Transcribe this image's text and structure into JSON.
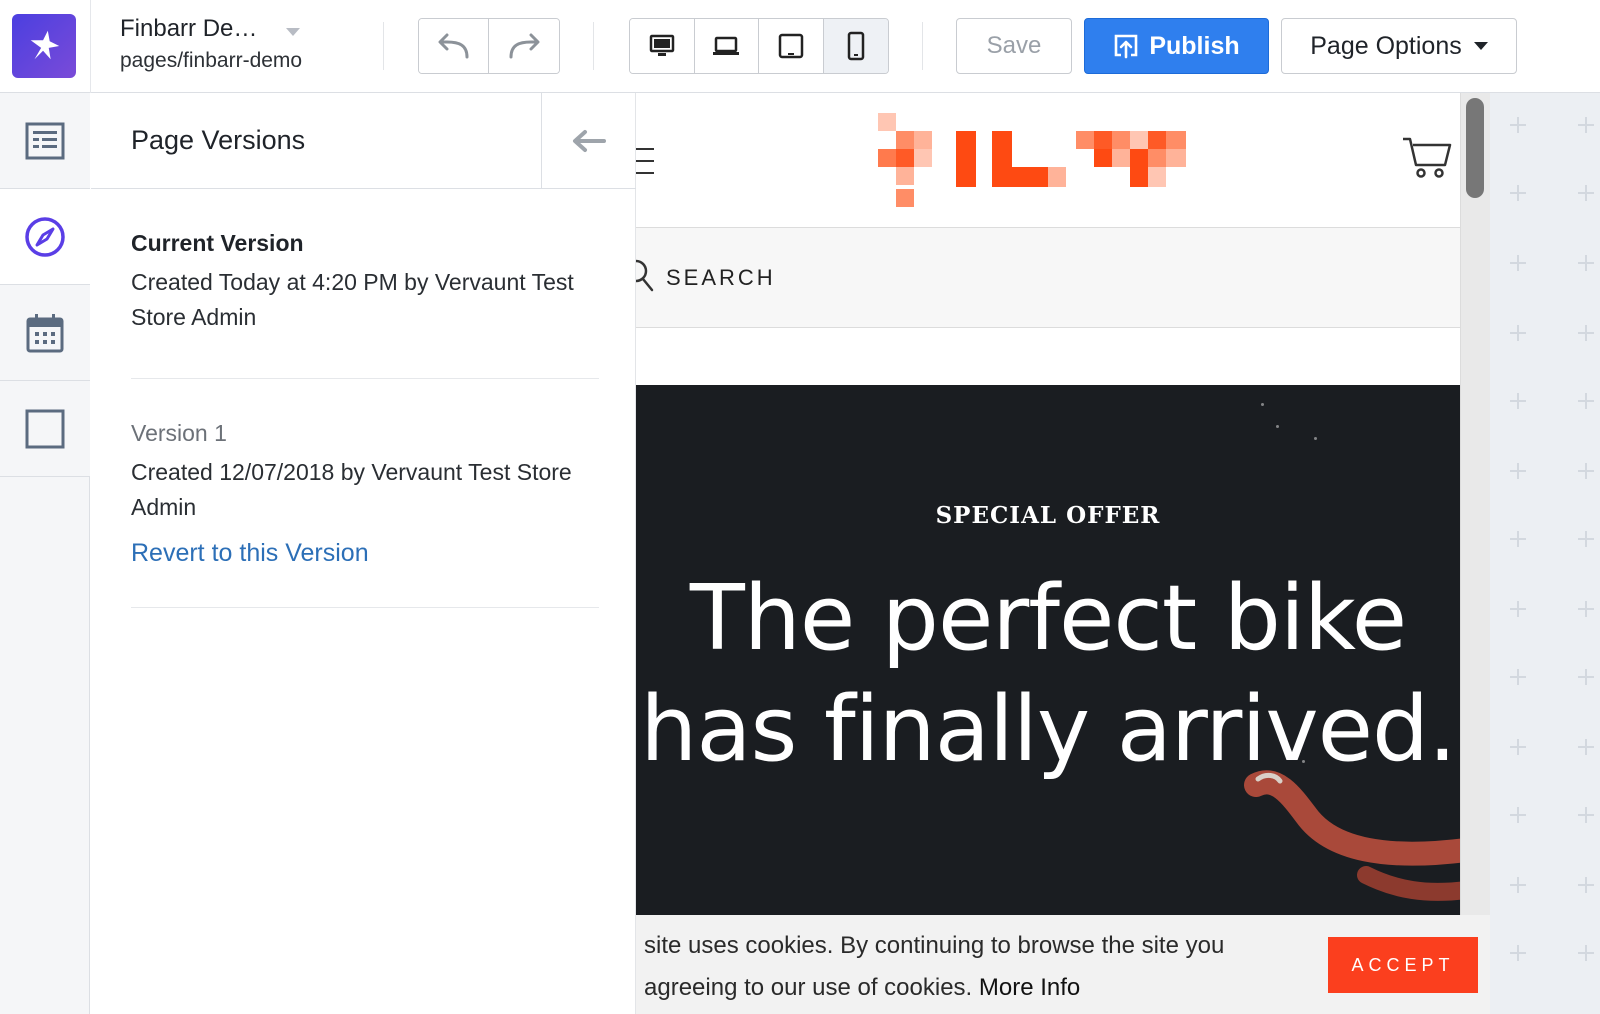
{
  "toolbar": {
    "page_name": "Finbarr De…",
    "page_path": "pages/finbarr-demo",
    "save_label": "Save",
    "publish_label": "Publish",
    "options_label": "Page Options",
    "active_device": "mobile",
    "colors": {
      "publish": "#2f7fee",
      "logo_start": "#4b3fe0",
      "logo_end": "#7a4bd8"
    }
  },
  "rail": {
    "items": [
      {
        "icon": "layout-list-icon",
        "active": false
      },
      {
        "icon": "compass-icon",
        "active": true
      },
      {
        "icon": "calendar-icon",
        "active": false
      },
      {
        "icon": "square-icon",
        "active": false
      }
    ]
  },
  "panel": {
    "title": "Page Versions",
    "current": {
      "title": "Current Version",
      "desc": "Created Today at 4:20 PM by Vervaunt Test Store Admin"
    },
    "v1": {
      "title": "Version 1",
      "desc": "Created 12/07/2018 by Vervaunt Test Store Admin",
      "revert_label": "Revert to this Version"
    }
  },
  "site": {
    "search_label": "SEARCH",
    "hero_kicker": "SPECIAL OFFER",
    "hero_headline": "The perfect bike has finally arrived.",
    "cookie_text": "site uses cookies. By continuing to browse the site you agreeing to our use of cookies.",
    "cookie_more": "More Info",
    "accept_label": "ACCEPT",
    "accent": "#fb3f1e"
  }
}
